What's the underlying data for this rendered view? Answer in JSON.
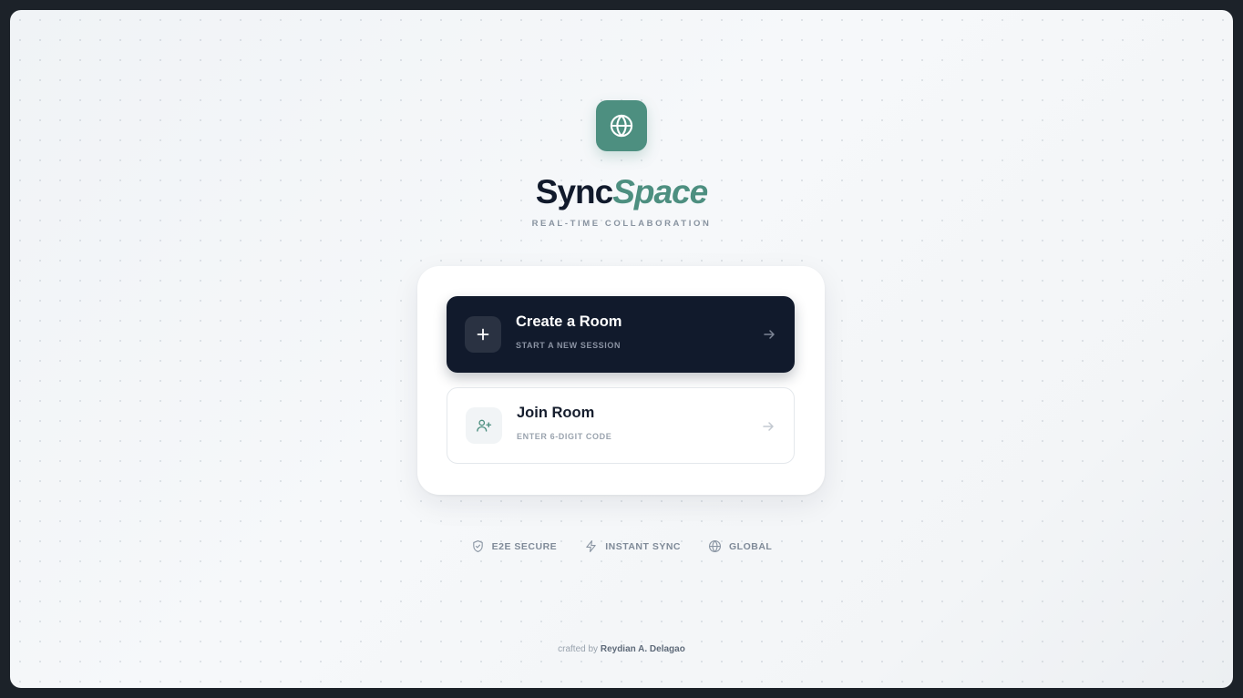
{
  "brand": {
    "name_part1": "Sync",
    "name_part2": "Space",
    "tagline": "REAL-TIME COLLABORATION",
    "logo_icon": "globe-icon",
    "accent_color": "#4d8f80",
    "dark_color": "#111a2c"
  },
  "options": {
    "create": {
      "title": "Create a Room",
      "subtitle": "START A NEW SESSION",
      "icon": "plus-icon"
    },
    "join": {
      "title": "Join Room",
      "subtitle": "ENTER 6-DIGIT CODE",
      "icon": "user-plus-icon"
    }
  },
  "features": [
    {
      "label": "E2E SECURE",
      "icon": "shield-check-icon"
    },
    {
      "label": "INSTANT SYNC",
      "icon": "lightning-icon"
    },
    {
      "label": "GLOBAL",
      "icon": "globe-icon"
    }
  ],
  "footer": {
    "prefix": "crafted by",
    "author": "Reydian A. Delagao"
  }
}
